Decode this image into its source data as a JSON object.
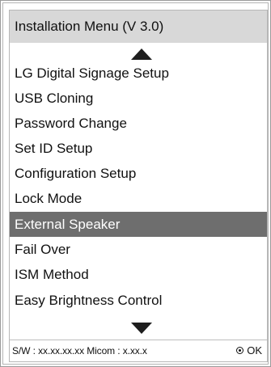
{
  "menu": {
    "title": "Installation Menu (V 3.0)",
    "selected_index": 6,
    "items": [
      {
        "label": "LG Digital Signage Setup"
      },
      {
        "label": "USB Cloning"
      },
      {
        "label": "Password Change"
      },
      {
        "label": "Set ID Setup"
      },
      {
        "label": "Configuration Setup"
      },
      {
        "label": "Lock Mode"
      },
      {
        "label": "External Speaker"
      },
      {
        "label": "Fail Over"
      },
      {
        "label": "ISM Method"
      },
      {
        "label": "Easy Brightness Control"
      }
    ]
  },
  "footer": {
    "info": "S/W : xx.xx.xx.xx Micom : x.xx.x",
    "ok_label": "OK",
    "ok_icon": "ok-button-icon"
  },
  "icons": {
    "scroll_up": "triangle-up-icon",
    "scroll_down": "triangle-down-icon"
  },
  "colors": {
    "title_bar": "#d8d8d8",
    "selected_bg": "#6e6e6e",
    "selected_text": "#ffffff",
    "text": "#111111"
  }
}
